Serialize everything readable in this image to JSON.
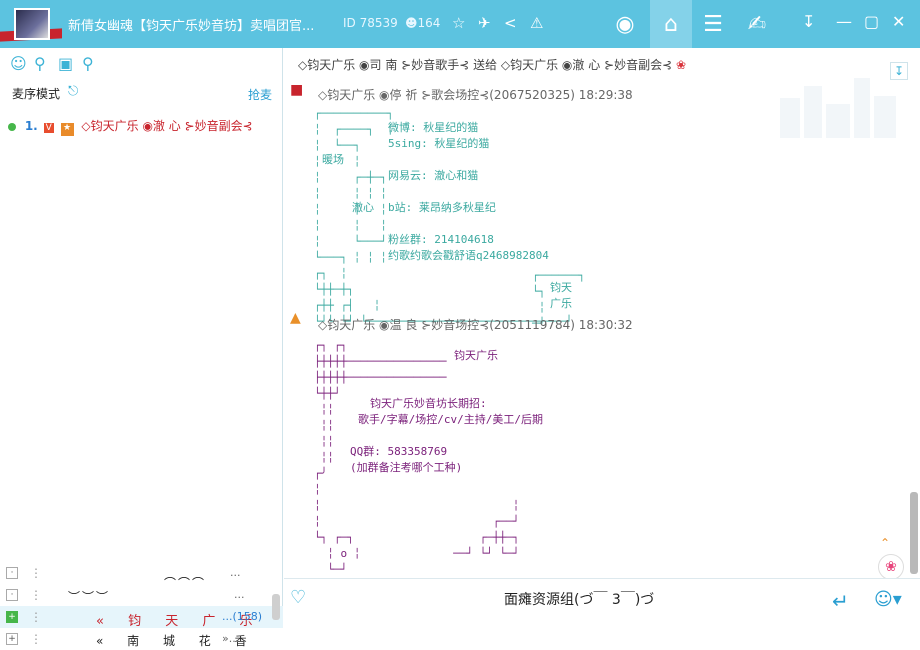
{
  "titlebar": {
    "title": "新倩女幽魂【钧天广乐妙音坊】卖唱团官...",
    "room_id": "ID 78539",
    "user_count": "164"
  },
  "left": {
    "mic_mode": "麦序模式",
    "grab_mic": "抢麦",
    "queue": [
      {
        "num": "1.",
        "badge": "V",
        "name": "◇钧天广乐 ◉澈 心 ⊱妙音副会⊰"
      }
    ],
    "rooms": [
      {
        "name": "︵︵︵",
        "dots": "...",
        "style": "plain"
      },
      {
        "name": "︶︶︶",
        "dots": "...",
        "style": "plain"
      },
      {
        "name": "« 钧 天 广 乐",
        "count": "...(158)",
        "style": "red"
      },
      {
        "name": "« 南 城 花 香",
        "dots": "»...",
        "style": "blk"
      }
    ]
  },
  "chat": {
    "gift_bar": "◇钧天广乐 ◉司 南 ⊱妙音歌手⊰ 送给   ◇钧天广乐 ◉澈 心 ⊱妙音副会⊰",
    "messages": [
      {
        "sender": "◇钧天广乐 ◉停 祈 ⊱歌会场控⊰(2067520325) 18:29:38"
      },
      {
        "sender": "◇钧天广乐 ◉温 良 ⊱妙音场控⊰(2051119784) 18:30:32"
      }
    ],
    "art1": {
      "weibo": "微博: 秋星纪的猫",
      "fivesing": "5sing: 秋星纪的猫",
      "nuanchang": "暖场",
      "netease": "网易云: 澈心和猫",
      "che_xin": "澈心",
      "bilibili": "b站: 莱昂纳多秋星纪",
      "fans_group": "粉丝群: 214104618",
      "contact": "约歌约歌会戳舒语q2468982804",
      "jun_tian": "钧天",
      "guang_le": "广乐"
    },
    "art2": {
      "brand": "钧天广乐",
      "recruit": "钧天广乐妙音坊长期招:",
      "roles": "歌手/字幕/场控/cv/主持/美工/后期",
      "qq_group": "QQ群: 583358769",
      "note": "(加群备注考哪个工种)"
    },
    "announce": "面瘫资源组(づ￣ 3￣)づ"
  },
  "colors": {
    "accent": "#5cc3e0",
    "teal_text": "#3ba9a0",
    "purple_text": "#7a1f7a",
    "red_name": "#c8242d"
  },
  "icons": [
    "avatar",
    "star-icon",
    "plane-icon",
    "share-icon",
    "alert-icon",
    "music-icon",
    "home-icon",
    "list-icon",
    "game-icon",
    "download-icon",
    "minimize-icon",
    "maximize-icon",
    "close-icon",
    "person-icon",
    "location-icon",
    "screen-icon",
    "search-icon",
    "mic-icon",
    "gift-icon",
    "rose-icon",
    "font-icon",
    "send-icon",
    "emoji-icon"
  ]
}
